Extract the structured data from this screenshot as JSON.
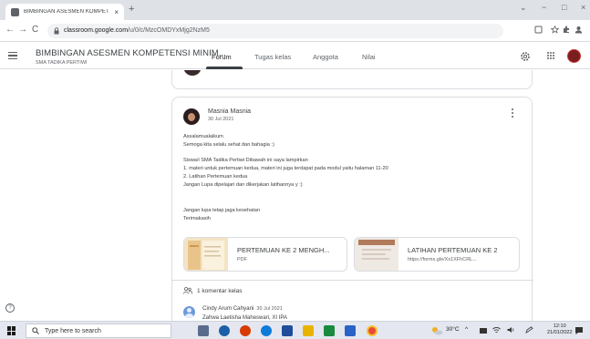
{
  "browser": {
    "tab_title": "BIMBINGAN ASESMEN KOMPETI",
    "tab_close": "×",
    "new_tab": "+",
    "url_host": "classroom.google.com",
    "url_path": "/u/0/c/MzcOMDYxMjg2NzM5",
    "back": "←",
    "forward": "→",
    "reload": "C",
    "win_min": "−",
    "win_max": "□",
    "win_close": "×",
    "win_chevron": "⌄"
  },
  "header": {
    "class_title": "BIMBINGAN ASESMEN KOMPETENSI MINIM...",
    "class_subtitle": "SMA TADIKA PERTIWI",
    "tabs": [
      {
        "label": "Forum"
      },
      {
        "label": "Tugas kelas"
      },
      {
        "label": "Anggota"
      },
      {
        "label": "Nilai"
      }
    ]
  },
  "post": {
    "author": "Masnia Masnia",
    "date": "30 Jul 2021",
    "lines": [
      "Assalamualaikum",
      "Semoga kita selalu sehat dan bahagia :)",
      "",
      "Siswa/i SMA Tadika Pertiwi Dibawah ini saya lampirkan",
      "1. materi untuk pertemuan kedua, materi ini juga terdapat pada modul yaitu halaman 11-20",
      "2. Latihan Pertemuan kedua",
      "Jangan Lupa dipelajari dan dikerjakan latihannya y :)",
      "",
      "",
      "Jangan lupa tetap jaga kesehatan",
      "Terimakasih"
    ],
    "attachments": [
      {
        "title": "PERTEMUAN KE 2 MENGH...",
        "subtitle": "PDF"
      },
      {
        "title": "LATIHAN PERTEMUAN KE 2",
        "subtitle": "https://forms.gle/Xs1XFhCRL..."
      }
    ],
    "comments_count_label": "1 komentar kelas",
    "comment": {
      "author": "Cindy Arum Cahyani",
      "date": "30 Jul 2021",
      "text": "Zahwa Laetisha Maheswari, XI IPA"
    }
  },
  "help": "?",
  "taskbar": {
    "search_placeholder": "Type here to search",
    "weather": "30°C",
    "tray_chevron": "^",
    "time": "12:10",
    "date": "21/01/2022"
  },
  "colors": {
    "accent": "#1a73e8",
    "border": "#dadce0"
  }
}
